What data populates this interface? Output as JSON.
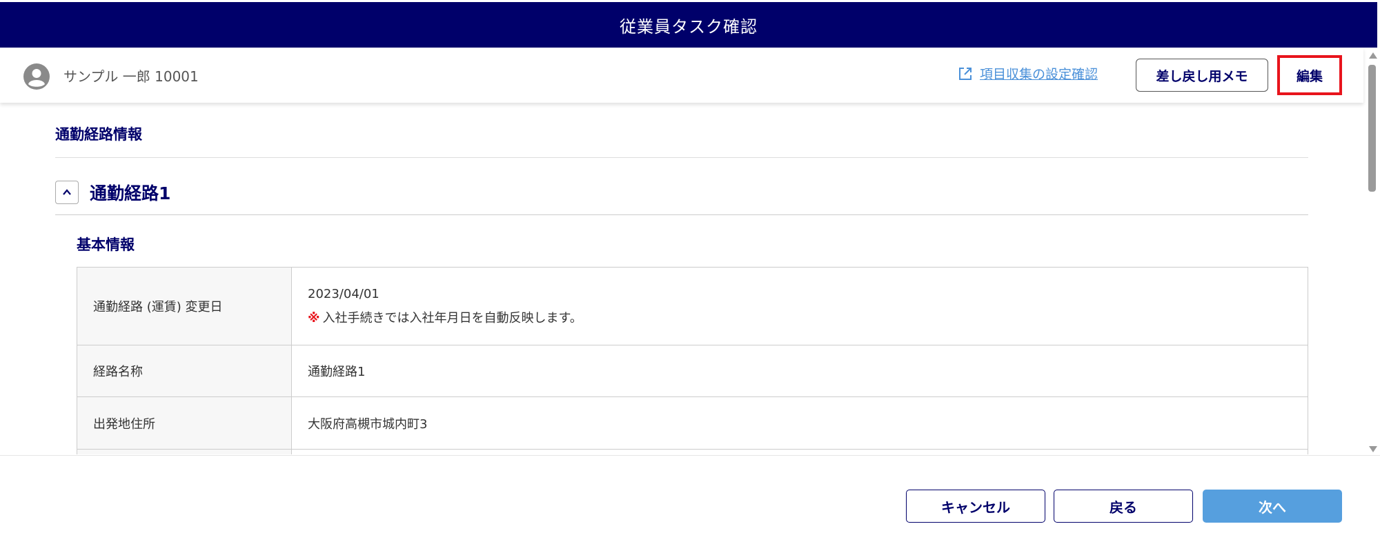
{
  "window": {
    "title": "従業員タスク確認"
  },
  "header": {
    "user_name": "サンプル 一郎 10001",
    "settings_link_label": "項目収集の設定確認",
    "memo_button_label": "差し戻し用メモ",
    "edit_button_label": "編集"
  },
  "main": {
    "section_title": "通勤経路情報",
    "route_title": "通勤経路1",
    "subsection_title": "基本情報",
    "rows": [
      {
        "label": "通勤経路 (運賃) 変更日",
        "value": "2023/04/01",
        "note_mark": "※",
        "note": "入社手続きでは入社年月日を自動反映します。"
      },
      {
        "label": "経路名称",
        "value": "通勤経路1"
      },
      {
        "label": "出発地住所",
        "value": "大阪府高槻市城内町3"
      }
    ]
  },
  "footer": {
    "cancel_label": "キャンセル",
    "back_label": "戻る",
    "next_label": "次へ"
  },
  "colors": {
    "primary_navy": "#00006a",
    "link_blue": "#4a90d9",
    "next_button": "#569fde",
    "highlight_red": "#e8141c"
  },
  "icons": {
    "avatar": "user-avatar-icon",
    "external_link": "external-link-icon",
    "collapse": "chevron-up-icon"
  }
}
